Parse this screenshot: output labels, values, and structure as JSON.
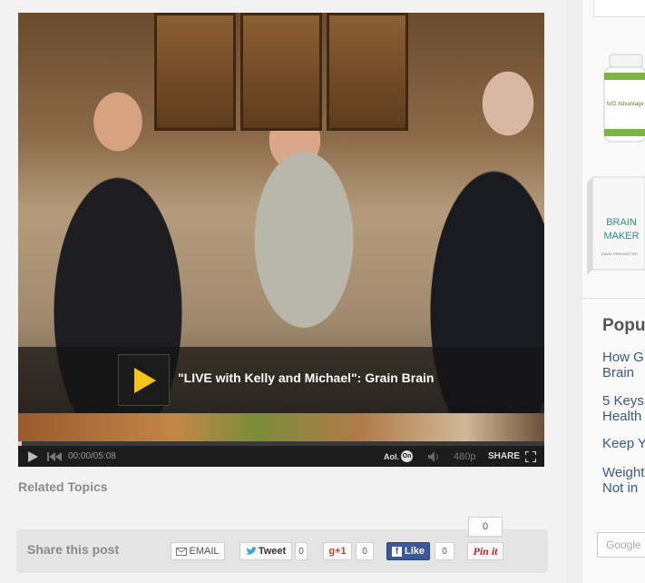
{
  "video": {
    "title": "\"LIVE with Kelly and Michael\": Grain Brain",
    "time": "00:00/05:08",
    "quality": "480p",
    "share_label": "SHARE",
    "brand": "Aol.",
    "brand_badge": "On",
    "progress": 0.0
  },
  "related_topics": "Related Topics",
  "share": {
    "label": "Share this post",
    "email_label": "EMAIL",
    "tweet_label": "Tweet",
    "tweet_count": "0",
    "gplus_label": "+1",
    "gplus_count": "0",
    "like_label": "Like",
    "like_count": "0",
    "pin_label": "Pin it",
    "pin_count": "0"
  },
  "sidebar": {
    "bottle_label": "Nrf2 Advantage",
    "book_title_1": "BRAIN",
    "book_title_2": "MAKER",
    "book_author": "DAVID PERLMUTTER",
    "popular_title": "Popu",
    "popular_items": [
      {
        "line1": "How G",
        "line2": "Brain"
      },
      {
        "line1": "5 Keys",
        "line2": "Health"
      },
      {
        "line1": "Keep Y",
        "line2": ""
      },
      {
        "line1": "Weight",
        "line2": "Not in"
      }
    ],
    "search_placeholder": "Google"
  },
  "colors": {
    "play_yellow": "#f6c417",
    "twitter_blue": "#2fa8e0",
    "gplus_red": "#d0402f",
    "facebook_blue": "#3b5998",
    "pinterest_red": "#cb2027",
    "link_blue": "#3a5a86"
  }
}
